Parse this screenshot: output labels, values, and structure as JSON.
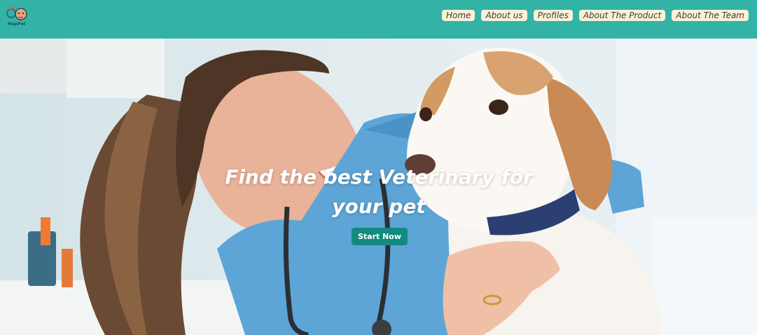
{
  "brand": {
    "logo_text": "MapPet"
  },
  "nav": {
    "items": [
      {
        "label": "Home"
      },
      {
        "label": "About us"
      },
      {
        "label": "Profiles"
      },
      {
        "label": "About The Product"
      },
      {
        "label": "About The Team"
      }
    ]
  },
  "hero": {
    "title": "Find the best Veterinary for your pet",
    "cta_label": "Start Now"
  },
  "colors": {
    "header": "#33b3a6",
    "nav_pill": "#fbf1d8",
    "cta": "#138a80"
  }
}
